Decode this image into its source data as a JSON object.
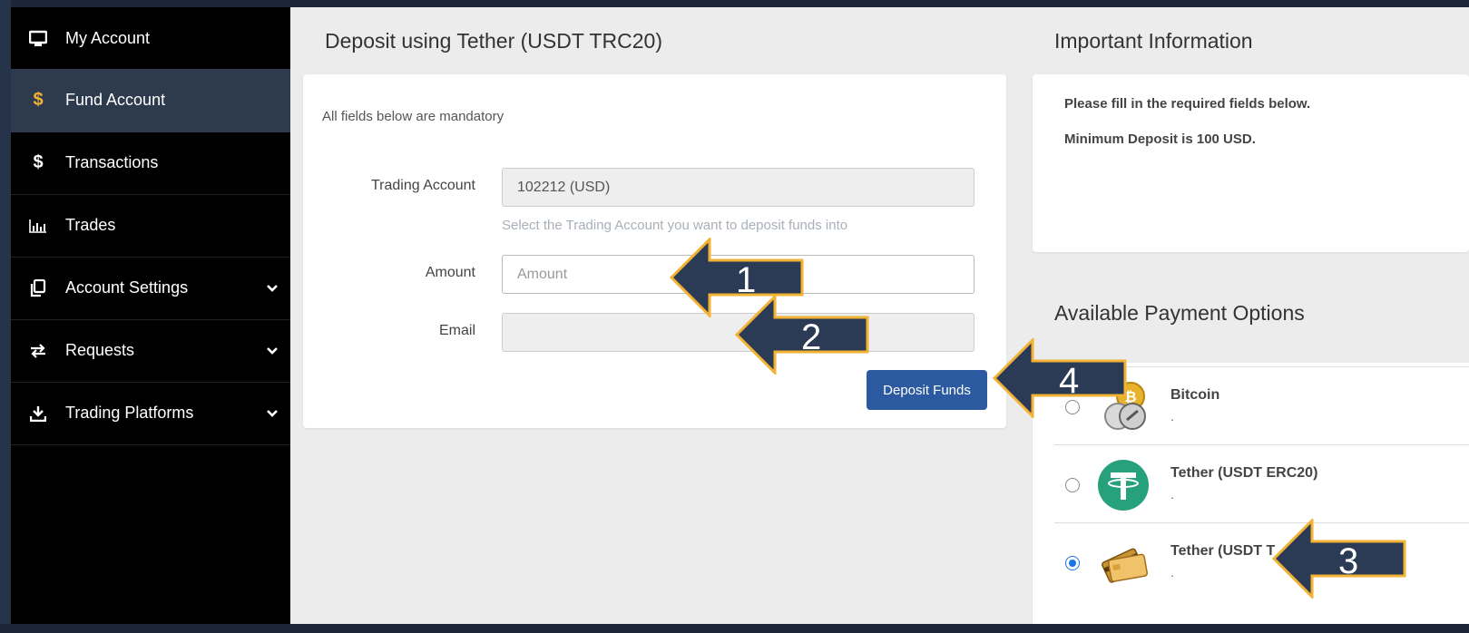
{
  "sidebar": {
    "items": [
      {
        "label": "My Account",
        "icon": "monitor-icon"
      },
      {
        "label": "Fund Account",
        "icon": "dollar-icon",
        "active": true
      },
      {
        "label": "Transactions",
        "icon": "dollar-icon"
      },
      {
        "label": "Trades",
        "icon": "bar-chart-icon"
      },
      {
        "label": "Account Settings",
        "icon": "copy-icon",
        "expandable": true
      },
      {
        "label": "Requests",
        "icon": "exchange-icon",
        "expandable": true
      },
      {
        "label": "Trading Platforms",
        "icon": "download-icon",
        "expandable": true
      }
    ]
  },
  "deposit": {
    "title": "Deposit using Tether (USDT TRC20)",
    "mandatory_note": "All fields below are mandatory",
    "trading_account": {
      "label": "Trading Account",
      "value": "102212 (USD)",
      "hint": "Select the Trading Account you want to deposit funds into"
    },
    "amount": {
      "label": "Amount",
      "placeholder": "Amount",
      "value": ""
    },
    "email": {
      "label": "Email",
      "value": ""
    },
    "submit_label": "Deposit Funds"
  },
  "info": {
    "title": "Important Information",
    "line1": "Please fill in the required fields below.",
    "line2": "Minimum Deposit is 100 USD."
  },
  "payment": {
    "title": "Available Payment Options",
    "options": [
      {
        "name": "Bitcoin",
        "desc": ".",
        "selected": false,
        "icon": "bitcoin-coins-icon"
      },
      {
        "name": "Tether (USDT ERC20)",
        "desc": ".",
        "selected": false,
        "icon": "tether-icon"
      },
      {
        "name": "Tether (USDT T",
        "desc": ".",
        "selected": true,
        "icon": "credit-cards-icon"
      }
    ]
  },
  "annotations": {
    "step1": "1",
    "step2": "2",
    "step3": "3",
    "step4": "4"
  },
  "colors": {
    "sidebar_bg": "#000000",
    "active_bg": "#2e3a4d",
    "accent_gold": "#f2b233",
    "button_blue": "#2c5aa0",
    "arrow_fill": "#2b3a55",
    "arrow_border": "#f2b233"
  }
}
